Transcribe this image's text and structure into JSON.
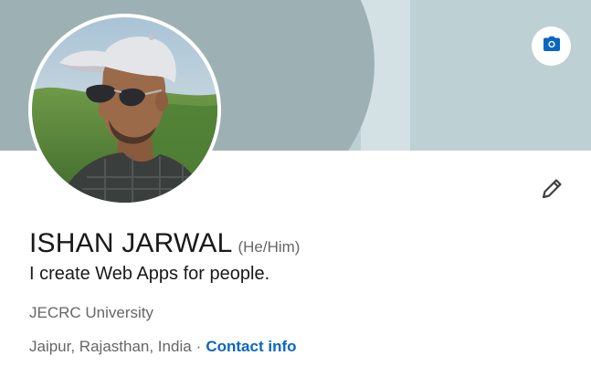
{
  "profile": {
    "name": "ISHAN JARWAL",
    "pronouns": "(He/Him)",
    "headline": "I create Web Apps for people.",
    "education": "JECRC University",
    "location": "Jaipur, Rajasthan, India",
    "separator": "·",
    "contact_link": "Contact info"
  },
  "icons": {
    "cover_camera": "camera-icon",
    "edit": "pencil-icon"
  },
  "colors": {
    "cover_base": "#bdd0d4",
    "cover_shape": "#9db1b5",
    "link": "#0a66c2",
    "primary_text": "#191919",
    "secondary_text": "#666666"
  }
}
